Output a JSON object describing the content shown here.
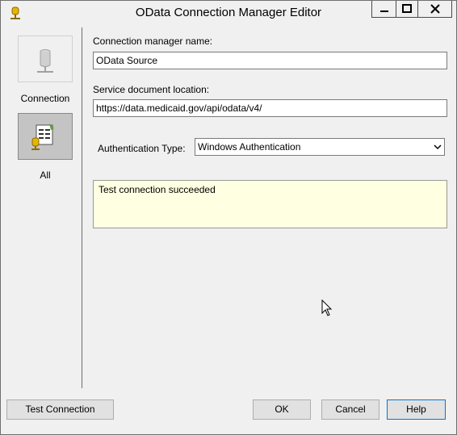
{
  "window": {
    "title": "OData Connection Manager Editor"
  },
  "sidebar": {
    "items": [
      {
        "label": "Connection",
        "icon": "database-connection-icon"
      },
      {
        "label": "All",
        "icon": "property-sheet-icon"
      }
    ]
  },
  "form": {
    "connection_name_label": "Connection manager name:",
    "connection_name_value": "OData Source",
    "service_location_label": "Service document location:",
    "service_location_value": "https://data.medicaid.gov/api/odata/v4/",
    "auth_type_label": "Authentication Type:",
    "auth_type_value": "Windows Authentication",
    "status_message": "Test connection succeeded"
  },
  "buttons": {
    "test_connection": "Test Connection",
    "ok": "OK",
    "cancel": "Cancel",
    "help": "Help"
  },
  "colors": {
    "status_background": "#ffffe1",
    "selected_nav_background": "#c4c4c4",
    "default_button_border": "#0078d7"
  }
}
